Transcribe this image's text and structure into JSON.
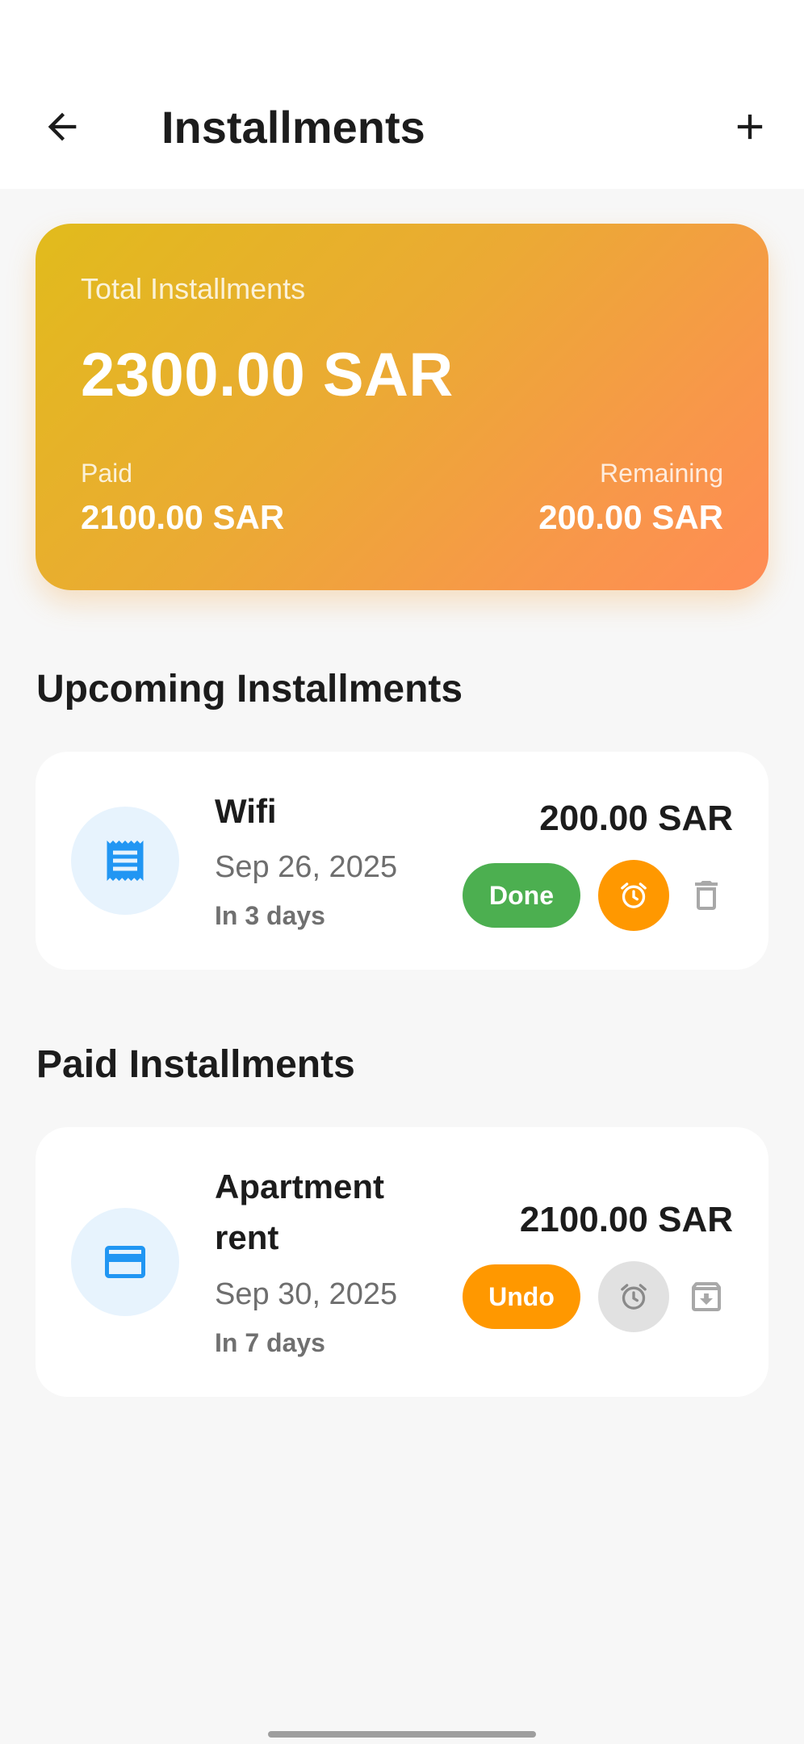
{
  "app_bar": {
    "title": "Installments",
    "back_icon": "arrow-left-icon",
    "add_icon": "plus-icon"
  },
  "summary": {
    "label": "Total Installments",
    "total": "2300.00 SAR",
    "paid_label": "Paid",
    "paid_value": "2100.00 SAR",
    "remaining_label": "Remaining",
    "remaining_value": "200.00 SAR",
    "gradient": [
      "#e1bb1c",
      "#ff8c55"
    ]
  },
  "upcoming": {
    "title": "Upcoming Installments",
    "items": [
      {
        "name": "Wifi",
        "date": "Sep 26, 2025",
        "due": "In 3 days",
        "amount": "200.00 SAR",
        "action_label": "Done",
        "category_icon": "receipt-icon",
        "reminder_icon": "alarm-clock-icon",
        "trailing_icon": "trash-icon",
        "action_color": "#4caf50",
        "reminder_color": "#ff9800"
      }
    ]
  },
  "paid": {
    "title": "Paid Installments",
    "items": [
      {
        "name": "Apartment rent",
        "date": "Sep 30, 2025",
        "due": "In 7 days",
        "amount": "2100.00 SAR",
        "action_label": "Undo",
        "category_icon": "credit-card-icon",
        "reminder_icon": "alarm-clock-icon",
        "trailing_icon": "archive-icon",
        "action_color": "#ff9800",
        "reminder_color": "#e1e1e1"
      }
    ]
  },
  "colors": {
    "background": "#f7f7f7",
    "icon_blue": "#2196f3",
    "icon_bg": "#e7f3fd"
  }
}
